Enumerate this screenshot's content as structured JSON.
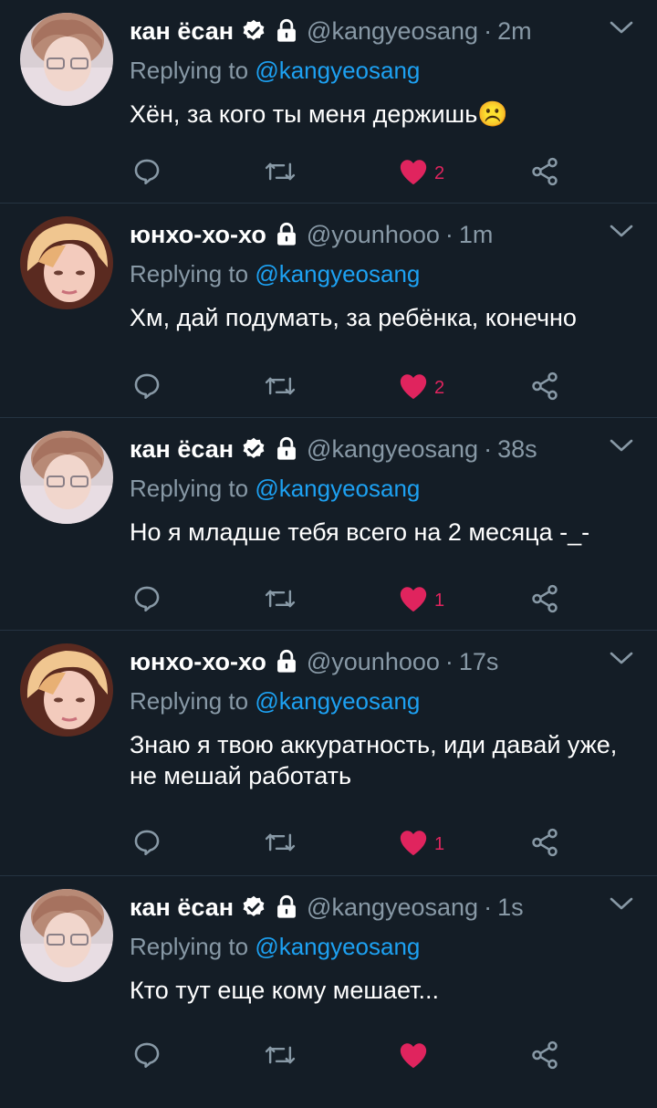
{
  "tweets": [
    {
      "name": "кан ёсан",
      "verified": true,
      "locked": true,
      "handle": "@kangyeosang",
      "dot": "·",
      "time": "2m",
      "replying_prefix": "Replying to",
      "replying_to": "@kangyeosang",
      "text": "Хён, за кого ты меня держишь☹️",
      "likes": "2",
      "avatar": "user-kangyeosang-avatar"
    },
    {
      "name": "юнхо-хо-хо",
      "verified": false,
      "locked": true,
      "handle": "@younhooo",
      "dot": "·",
      "time": "1m",
      "replying_prefix": "Replying to",
      "replying_to": "@kangyeosang",
      "text": "Хм, дай подумать, за ребёнка, конечно",
      "likes": "2",
      "avatar": "user-younhooo-avatar"
    },
    {
      "name": "кан ёсан",
      "verified": true,
      "locked": true,
      "handle": "@kangyeosang",
      "dot": "·",
      "time": "38s",
      "replying_prefix": "Replying to",
      "replying_to": "@kangyeosang",
      "text": "Но я младше тебя всего на 2 месяца -_-",
      "likes": "1",
      "avatar": "user-kangyeosang-avatar"
    },
    {
      "name": "юнхо-хо-хо",
      "verified": false,
      "locked": true,
      "handle": "@younhooo",
      "dot": "·",
      "time": "17s",
      "replying_prefix": "Replying to",
      "replying_to": "@kangyeosang",
      "text": "Знаю я твою аккуратность, иди давай уже, не мешай работать",
      "likes": "1",
      "avatar": "user-younhooo-avatar"
    },
    {
      "name": "кан ёсан",
      "verified": true,
      "locked": true,
      "handle": "@kangyeosang",
      "dot": "·",
      "time": "1s",
      "replying_prefix": "Replying to",
      "replying_to": "@kangyeosang",
      "text": "Кто тут еще кому мешает...",
      "likes": "",
      "avatar": "user-kangyeosang-avatar"
    }
  ],
  "colors": {
    "background": "#141d26",
    "secondary_text": "#8899a6",
    "link": "#1da1f2",
    "like": "#e0245e",
    "divider": "#253341"
  },
  "icons": [
    "reply-icon",
    "retweet-icon",
    "heart-icon",
    "share-icon",
    "verified-badge-icon",
    "lock-icon",
    "chevron-down-icon"
  ]
}
